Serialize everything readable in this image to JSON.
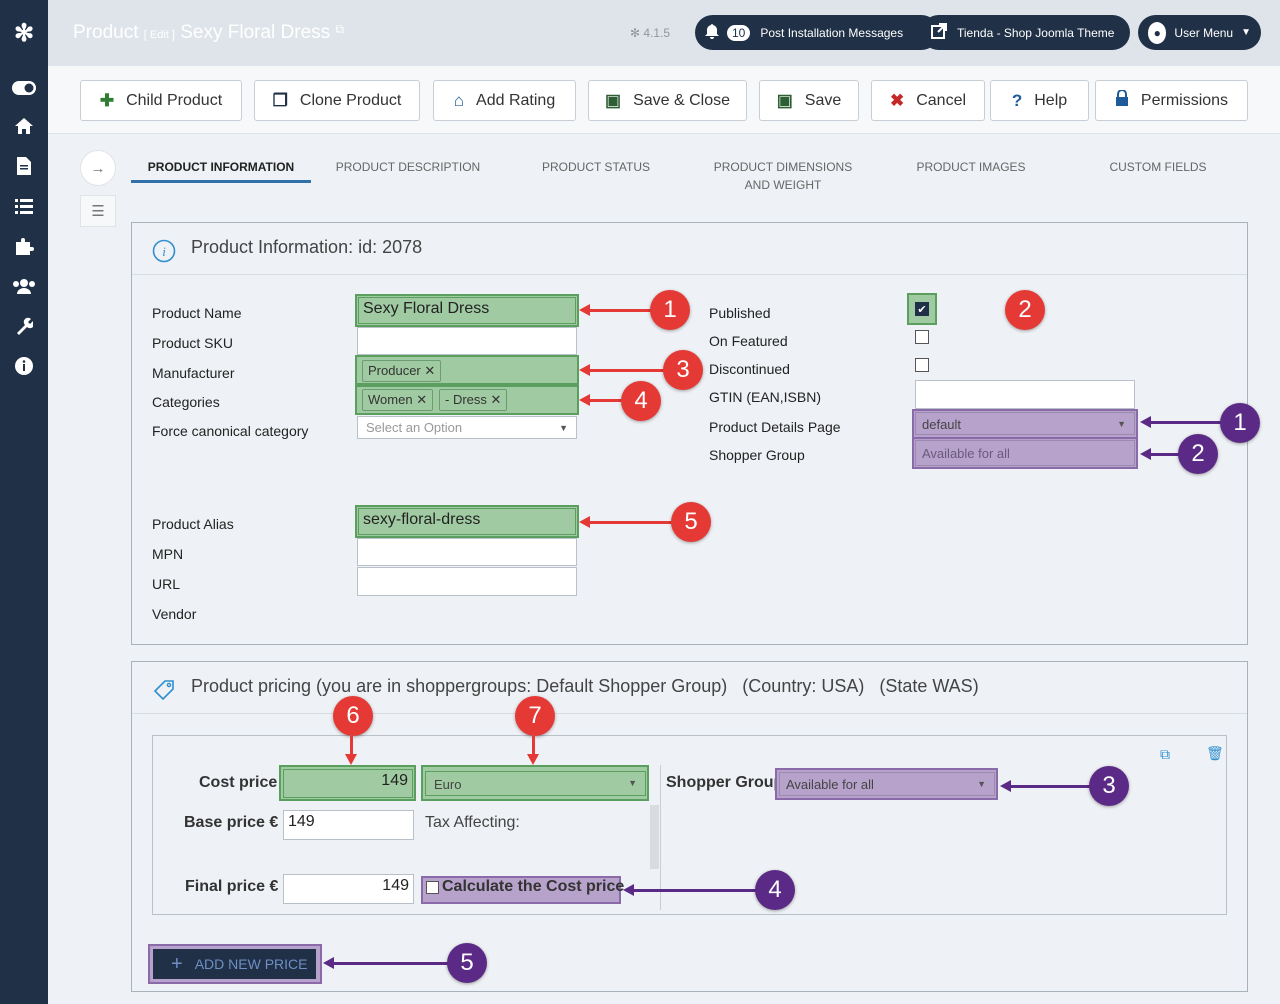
{
  "sidebar": {
    "logo_icon": "joomla-icon",
    "items": [
      "toggle-menu-icon",
      "home-icon",
      "content-icon",
      "list-icon",
      "extensions-icon",
      "users-icon",
      "system-icon",
      "info-icon"
    ]
  },
  "header": {
    "title_main": "Product",
    "title_small": "[ Edit ]",
    "title_product": "Sexy Floral Dress",
    "version": "4.1.5",
    "notifications_count": "10",
    "post_install_label": "Post Installation Messages",
    "site_label": "Tienda - Shop Joomla Theme",
    "user_menu_label": "User Menu"
  },
  "toolbar": {
    "child_product": "Child Product",
    "clone_product": "Clone Product",
    "add_rating": "Add Rating",
    "save_close": "Save & Close",
    "save": "Save",
    "cancel": "Cancel",
    "help": "Help",
    "permissions": "Permissions"
  },
  "tabs": [
    {
      "label": "PRODUCT INFORMATION"
    },
    {
      "label": "PRODUCT DESCRIPTION"
    },
    {
      "label": "PRODUCT STATUS"
    },
    {
      "label": "PRODUCT DIMENSIONS AND WEIGHT"
    },
    {
      "label": "PRODUCT IMAGES"
    },
    {
      "label": "CUSTOM FIELDS"
    }
  ],
  "info_panel": {
    "title": "Product Information: id: 2078",
    "labels": {
      "product_name": "Product Name",
      "product_sku": "Product SKU",
      "manufacturer": "Manufacturer",
      "categories": "Categories",
      "force_canonical": "Force canonical category",
      "product_alias": "Product Alias",
      "mpn": "MPN",
      "url": "URL",
      "vendor": "Vendor",
      "published": "Published",
      "on_featured": "On Featured",
      "discontinued": "Discontinued",
      "gtin": "GTIN (EAN,ISBN)",
      "details_page": "Product Details Page",
      "shopper_group": "Shopper Group"
    },
    "values": {
      "product_name": "Sexy Floral Dress",
      "product_sku": "",
      "manufacturer_tag": "Producer",
      "category_tag_1": "Women",
      "category_tag_2": "- Dress",
      "force_canonical_placeholder": "Select an Option",
      "product_alias": "sexy-floral-dress",
      "mpn": "",
      "url": "",
      "gtin": "",
      "details_page": "default",
      "shopper_group_placeholder": "Available for all"
    },
    "published": true,
    "on_featured": false,
    "discontinued": false
  },
  "pricing_panel": {
    "title": "Product pricing (you are in shoppergroups: Default Shopper Group)   (Country: USA)   (State WAS)",
    "cost_price_label": "Cost price",
    "cost_price_value": "149",
    "currency": "Euro",
    "base_price_label": "Base price €",
    "base_price_value": "149",
    "tax_affecting_label": "Tax Affecting:",
    "final_price_label": "Final price €",
    "final_price_value": "149",
    "calculate_cost_label": "Calculate the Cost price",
    "shopper_group_label": "Shopper Group",
    "shopper_group_value": "Available for all",
    "add_new_price_label": "ADD NEW PRICE"
  },
  "annotations": {
    "red": [
      "1",
      "2",
      "3",
      "4",
      "5",
      "6",
      "7"
    ],
    "purple": [
      "1",
      "2",
      "3",
      "4",
      "5"
    ],
    "colors": {
      "red": "#e53935",
      "purple": "#5b2a86",
      "green_highlight": "#a0cba2",
      "purple_highlight": "#b7a2cb"
    }
  }
}
